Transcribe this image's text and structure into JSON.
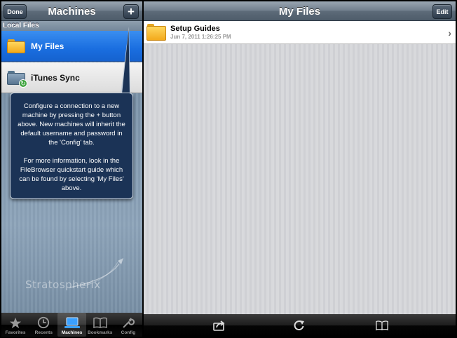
{
  "machines_panel": {
    "title": "Machines",
    "done_label": "Done",
    "add_label": "+",
    "section_header": "Local Files",
    "items": [
      {
        "label": "My Files",
        "icon": "folder-icon",
        "selected": true
      },
      {
        "label": "iTunes Sync",
        "icon": "itunes-sync-folder-icon",
        "selected": false
      }
    ],
    "popover": {
      "paragraph1": "Configure a connection to a new machine by pressing the + button above.  New machines will inherit the default username and password in the 'Config' tab.",
      "paragraph2": "For more information, look in the FileBrowser quickstart guide which can be found by selecting 'My Files' above."
    },
    "watermark": "Stratospherix",
    "tabs": [
      {
        "label": "Favorites",
        "icon": "star-icon"
      },
      {
        "label": "Recents",
        "icon": "clock-icon"
      },
      {
        "label": "Machines",
        "icon": "laptop-icon",
        "active": true
      },
      {
        "label": "Bookmarks",
        "icon": "book-icon"
      },
      {
        "label": "Config",
        "icon": "wrench-icon"
      }
    ]
  },
  "files_panel": {
    "title": "My Files",
    "edit_label": "Edit",
    "files": [
      {
        "name": "Setup Guides",
        "date": "Jun 7, 2011 1:26:25 PM",
        "icon": "folder-icon"
      }
    ],
    "toolbar": [
      "share-icon",
      "refresh-icon",
      "bookmarks-icon"
    ]
  },
  "colors": {
    "selection_blue": "#1a6ee0",
    "popover_navy": "#1b3356",
    "folder_orange": "#f2a91c"
  }
}
